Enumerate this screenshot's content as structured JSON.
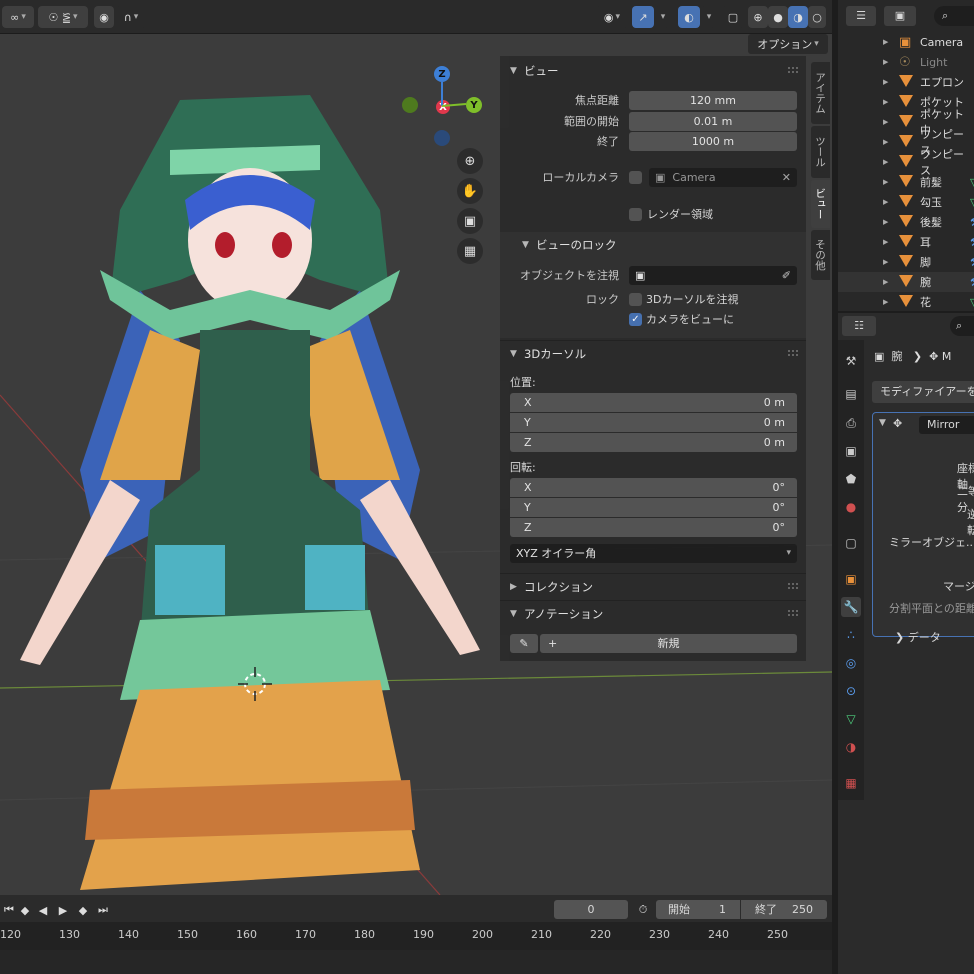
{
  "header": {
    "options_label": "オプション"
  },
  "gizmo": {
    "z": "Z",
    "y": "Y",
    "x": "X"
  },
  "npanel": {
    "tabs": [
      "アイテム",
      "ツール",
      "ビュー",
      "その他"
    ],
    "view": {
      "title": "ビュー",
      "focal_label": "焦点距離",
      "focal_value": "120 mm",
      "clip_start_label": "範囲の開始",
      "clip_start_value": "0.01 m",
      "clip_end_label": "終了",
      "clip_end_value": "1000 m",
      "local_camera_label": "ローカルカメラ",
      "local_camera_value": "Camera",
      "render_region_label": "レンダー領域"
    },
    "view_lock": {
      "title": "ビューのロック",
      "lock_object_label": "オブジェクトを注視",
      "lock_label": "ロック",
      "lock_cursor_label": "3Dカーソルを注視",
      "camera_to_view_label": "カメラをビューに"
    },
    "cursor": {
      "title": "3Dカーソル",
      "location_label": "位置:",
      "loc": [
        {
          "axis": "X",
          "value": "0 m"
        },
        {
          "axis": "Y",
          "value": "0 m"
        },
        {
          "axis": "Z",
          "value": "0 m"
        }
      ],
      "rotation_label": "回転:",
      "rot": [
        {
          "axis": "X",
          "value": "0°"
        },
        {
          "axis": "Y",
          "value": "0°"
        },
        {
          "axis": "Z",
          "value": "0°"
        }
      ],
      "mode": "XYZ オイラー角"
    },
    "collection_title": "コレクション",
    "annotation_title": "アノテーション",
    "new_label": "新規"
  },
  "outliner": {
    "items": [
      {
        "name": "Camera",
        "dim": false
      },
      {
        "name": "Light",
        "dim": true
      },
      {
        "name": "エプロン",
        "dim": false
      },
      {
        "name": "ポケット",
        "dim": false
      },
      {
        "name": "ポケット中",
        "dim": false
      },
      {
        "name": "ワンピース",
        "dim": false
      },
      {
        "name": "ワンピース",
        "dim": false
      },
      {
        "name": "前髪",
        "dim": false
      },
      {
        "name": "勾玉",
        "dim": false
      },
      {
        "name": "後髪",
        "dim": false
      },
      {
        "name": "耳",
        "dim": false
      },
      {
        "name": "脚",
        "dim": false
      },
      {
        "name": "腕",
        "dim": false
      },
      {
        "name": "花",
        "dim": false
      }
    ]
  },
  "properties": {
    "breadcrumb_object": "腕",
    "breadcrumb_mod": "M",
    "add_modifier": "モディファイアーを",
    "modifier_name": "Mirror",
    "rows": [
      "座標軸",
      "二等分",
      "逆転",
      "ミラーオブジェ...",
      "マージ",
      "分割平面との距離"
    ],
    "data_label": "データ"
  },
  "timeline": {
    "current_frame": "0",
    "start_label": "開始",
    "start_value": "1",
    "end_label": "終了",
    "end_value": "250",
    "ticks": [
      "120",
      "130",
      "140",
      "150",
      "160",
      "170",
      "180",
      "190",
      "200",
      "210",
      "220",
      "230",
      "240",
      "250"
    ]
  }
}
